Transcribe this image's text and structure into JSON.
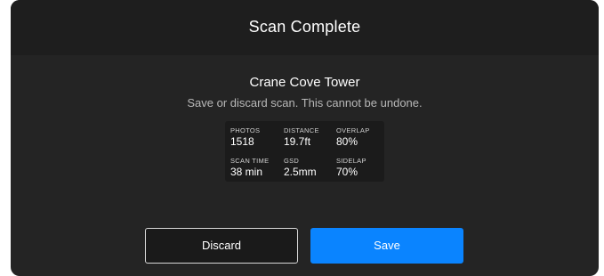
{
  "dialog": {
    "title": "Scan Complete",
    "scan_name": "Crane Cove Tower",
    "message": "Save or discard scan. This cannot be undone."
  },
  "stats": {
    "photos_label": "PHOTOS",
    "photos_value": "1518",
    "distance_label": "DISTANCE",
    "distance_value": "19.7ft",
    "overlap_label": "OVERLAP",
    "overlap_value": "80%",
    "scan_time_label": "SCAN TIME",
    "scan_time_value": "38 min",
    "gsd_label": "GSD",
    "gsd_value": "2.5mm",
    "sidelap_label": "SIDELAP",
    "sidelap_value": "70%"
  },
  "actions": {
    "discard_label": "Discard",
    "save_label": "Save"
  },
  "colors": {
    "accent": "#0a84ff",
    "dialog_background": "#242424",
    "header_background": "#1e1e1e"
  }
}
